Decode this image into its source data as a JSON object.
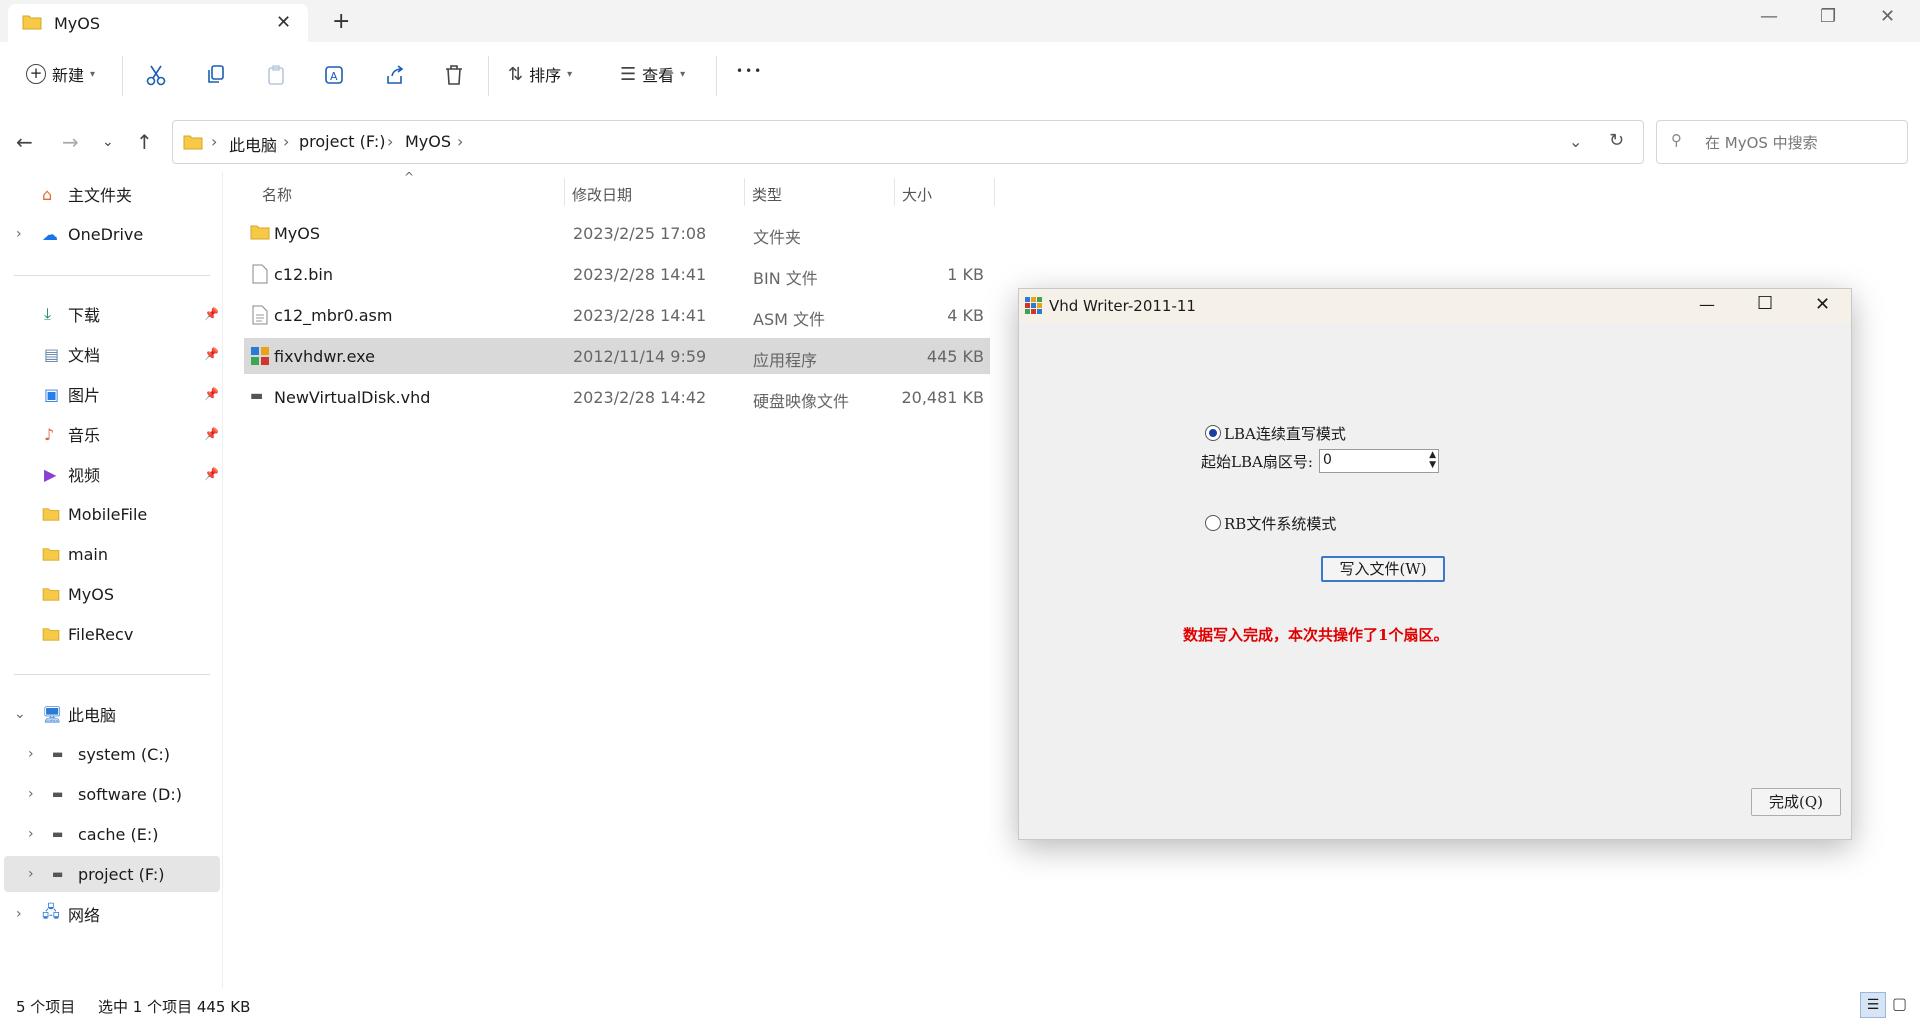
{
  "window": {
    "tab_title": "MyOS",
    "new_tab": "+",
    "minimize": "—",
    "restore": "❐",
    "close": "✕"
  },
  "toolbar": {
    "new_label": "新建",
    "sort_label": "排序",
    "view_label": "查看",
    "more_label": "•••"
  },
  "address": {
    "crumbs": [
      "此电脑",
      "project (F:)",
      "MyOS"
    ],
    "search_placeholder": "在 MyOS 中搜索"
  },
  "sidebar": {
    "home": "主文件夹",
    "onedrive": "OneDrive",
    "quick": [
      "下载",
      "文档",
      "图片",
      "音乐",
      "视频",
      "MobileFile",
      "main",
      "MyOS",
      "FileRecv"
    ],
    "this_pc": "此电脑",
    "drives": [
      "system (C:)",
      "software (D:)",
      "cache (E:)",
      "project (F:)"
    ],
    "network": "网络"
  },
  "list": {
    "headers": {
      "name": "名称",
      "date": "修改日期",
      "type": "类型",
      "size": "大小"
    },
    "rows": [
      {
        "name": "MyOS",
        "date": "2023/2/25 17:08",
        "type": "文件夹",
        "size": ""
      },
      {
        "name": "c12.bin",
        "date": "2023/2/28 14:41",
        "type": "BIN 文件",
        "size": "1 KB"
      },
      {
        "name": "c12_mbr0.asm",
        "date": "2023/2/28 14:41",
        "type": "ASM 文件",
        "size": "4 KB"
      },
      {
        "name": "fixvhdwr.exe",
        "date": "2012/11/14 9:59",
        "type": "应用程序",
        "size": "445 KB"
      },
      {
        "name": "NewVirtualDisk.vhd",
        "date": "2023/2/28 14:42",
        "type": "硬盘映像文件",
        "size": "20,481 KB"
      }
    ]
  },
  "status": {
    "count": "5 个项目",
    "selection": "选中 1 个项目  445 KB"
  },
  "dialog": {
    "title": "Vhd Writer-2011-11",
    "mode_lba": "LBA连续直写模式",
    "start_lba_label": "起始LBA扇区号:",
    "start_lba_value": "0",
    "mode_fs": "RB文件系统模式",
    "write_button": "写入文件(W)",
    "message": "数据写入完成，本次共操作了1个扇区。",
    "done_button": "完成(Q)",
    "message_color": "#e00000"
  }
}
